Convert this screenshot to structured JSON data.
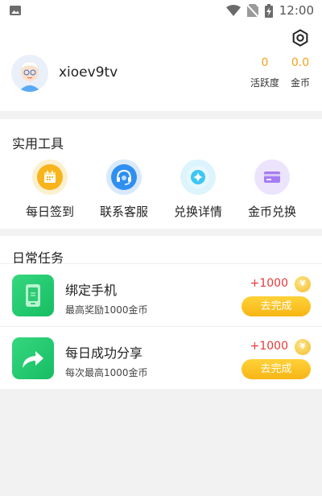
{
  "status_bar": {
    "time": "12:00",
    "icons": [
      "image-notification-icon",
      "wifi-icon",
      "no-sim-icon",
      "battery-charging-icon"
    ]
  },
  "profile": {
    "username": "xioev9tv",
    "stats": [
      {
        "value": "0",
        "label": "活跃度"
      },
      {
        "value": "0.0",
        "label": "金币"
      }
    ]
  },
  "tools": {
    "title": "实用工具",
    "items": [
      {
        "label": "每日签到",
        "icon": "calendar-icon",
        "color": "#f8b41b"
      },
      {
        "label": "联系客服",
        "icon": "headset-icon",
        "color": "#2f8ff0"
      },
      {
        "label": "兑换详情",
        "icon": "sparkle-icon",
        "color": "#3fc6f2"
      },
      {
        "label": "金币兑换",
        "icon": "card-icon",
        "color": "#a57cf5"
      }
    ]
  },
  "tasks": {
    "title": "日常任务",
    "items": [
      {
        "title": "绑定手机",
        "desc": "最高奖励1000金币",
        "reward": "+1000",
        "button": "去完成",
        "icon": "phone-icon"
      },
      {
        "title": "每日成功分享",
        "desc": "每次最高1000金币",
        "reward": "+1000",
        "button": "去完成",
        "icon": "share-arrow-icon"
      }
    ]
  },
  "colors": {
    "accent_yellow": "#f7b514",
    "reward_red": "#e53a3a",
    "task_green": "#1fc46a",
    "stat_orange": "#f1a21a"
  }
}
